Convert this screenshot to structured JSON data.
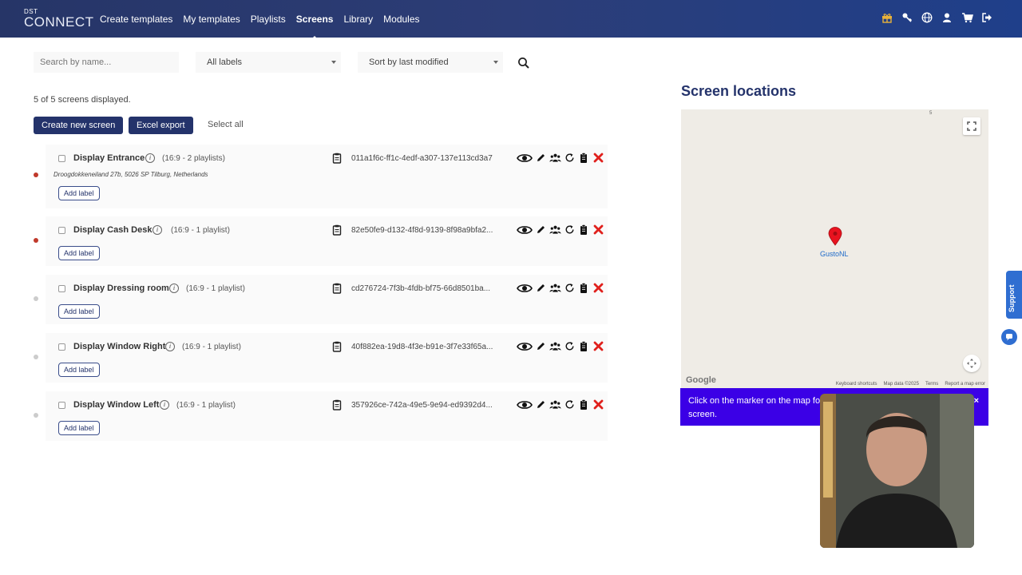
{
  "brand": {
    "top": "DST",
    "bottom": "CONNECT"
  },
  "nav": {
    "items": [
      "Create templates",
      "My templates",
      "Playlists",
      "Screens",
      "Library",
      "Modules"
    ],
    "active": "Screens"
  },
  "header_icons": [
    "gift-icon",
    "key-icon",
    "globe-icon",
    "user-icon",
    "cart-icon",
    "logout-icon"
  ],
  "filters": {
    "search_placeholder": "Search by name...",
    "labels_value": "All labels",
    "sort_value": "Sort by last modified"
  },
  "summary": {
    "count_text": "5 of 5 screens displayed."
  },
  "buttons": {
    "create": "Create new screen",
    "export": "Excel export",
    "select_all": "Select all"
  },
  "screens": [
    {
      "name": "Display Entrance",
      "meta": "(16:9 - 2 playlists)",
      "address": "Droogdokkeneiland 27b, 5026 SP Tilburg, Netherlands",
      "id": "011a1f6c-ff1c-4edf-a307-137e113cd3a7",
      "status_color": "#c0392b",
      "add_label": "Add label"
    },
    {
      "name": "Display Cash Desk",
      "meta": "(16:9 - 1 playlist)",
      "address": "",
      "id": "82e50fe9-d132-4f8d-9139-8f98a9bfa2...",
      "status_color": "#c0392b",
      "add_label": "Add label"
    },
    {
      "name": "Display Dressing room",
      "meta": "(16:9 - 1 playlist)",
      "address": "",
      "id": "cd276724-7f3b-4fdb-bf75-66d8501ba...",
      "status_color": "#cccccc",
      "add_label": "Add label"
    },
    {
      "name": "Display Window Right",
      "meta": "(16:9 - 1 playlist)",
      "address": "",
      "id": "40f882ea-19d8-4f3e-b91e-3f7e33f65a...",
      "status_color": "#cccccc",
      "add_label": "Add label"
    },
    {
      "name": "Display Window Left",
      "meta": "(16:9 - 1 playlist)",
      "address": "",
      "id": "357926ce-742a-49e5-9e94-ed9392d4...",
      "status_color": "#cccccc",
      "add_label": "Add label"
    }
  ],
  "map": {
    "title": "Screen locations",
    "marker_label": "GustoNL",
    "google": "Google",
    "footer": [
      "Keyboard shortcuts",
      "Map data ©2025",
      "Terms",
      "Report a map error"
    ],
    "tiny_label": "5"
  },
  "notice": {
    "text_line1": "Click on the marker on the map for",
    "text_line2": "screen.",
    "close": "×"
  },
  "support": {
    "label": "Support"
  },
  "colors": {
    "header": "#263567",
    "accent": "#24336b",
    "notice": "#3b00e6",
    "delete": "#e0201c",
    "marker": "#e8131f"
  }
}
